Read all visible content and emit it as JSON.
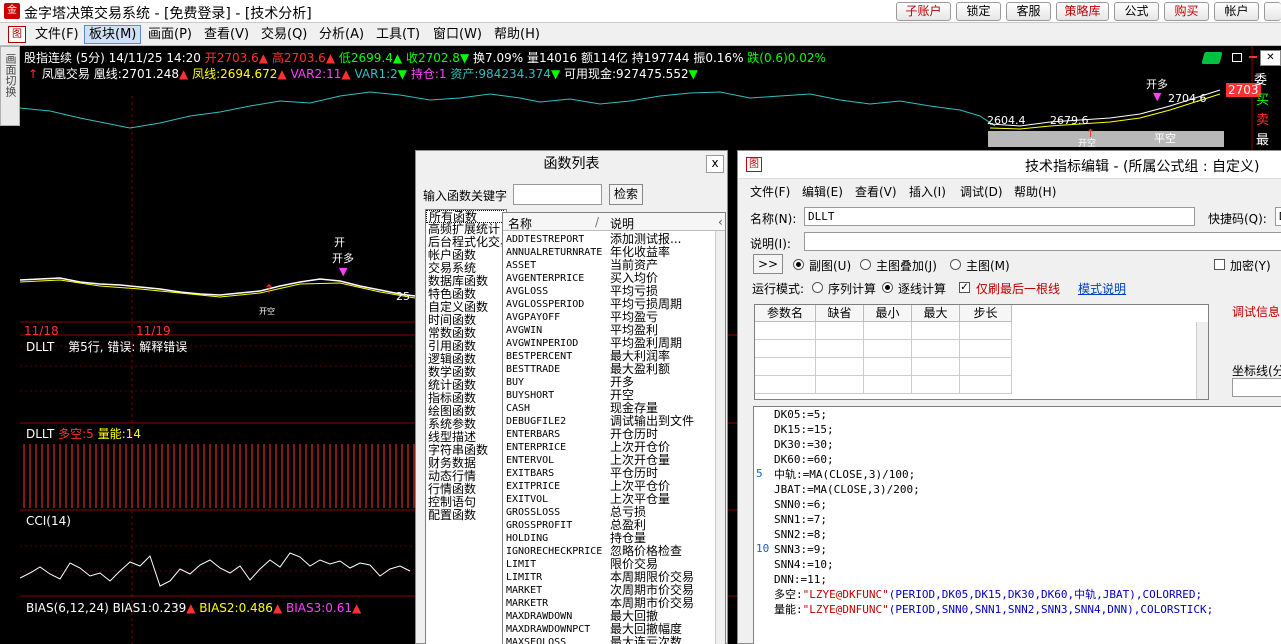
{
  "window": {
    "title": "金字塔决策交易系统 - [免费登录] - [技术分析]",
    "buttons": [
      "子账户",
      "锁定",
      "客服",
      "策略库",
      "公式",
      "购买",
      "帐户"
    ]
  },
  "menubar": {
    "items": [
      "文件(F)",
      "板块(M)",
      "画面(P)",
      "查看(V)",
      "交易(Q)",
      "分析(A)",
      "工具(T)",
      "窗口(W)",
      "帮助(H)"
    ],
    "selected": "板块(M)"
  },
  "left_tab": "画面切换",
  "quote": {
    "name": "股指连续 (5分) 14/11/25 14:20",
    "open": "开2703.6",
    "high": "高2703.6",
    "low": "低2699.4",
    "close": "收2702.8",
    "turnover": "换7.09%",
    "volume": "量14016",
    "amount": "额114亿",
    "position": "持197744",
    "amplitude": "振0.16%",
    "change": "跌(0.6)0.02%"
  },
  "indicator_line": {
    "name": "凤凰交易",
    "huang": "凰线:2701.248",
    "feng": "凤线:2694.672",
    "var2": "VAR2:11",
    "var1": "VAR1:2",
    "chicang": "持仓:1",
    "zichan": "资产:984234.374",
    "cash": "可用现金:927475.552"
  },
  "chart_labels": {
    "price_right": "2703",
    "top_right_a": "2704.6",
    "label_a": "2604.4",
    "label_b": "2679.6",
    "short_label": "25",
    "date1": "11/18",
    "date2": "11/19",
    "right_chars": [
      "委",
      "买",
      "卖",
      "最"
    ],
    "sell_mark": "开空",
    "buy_mark": "平空",
    "short_top": "开",
    "mark_pair": "开多"
  },
  "pane_dllt1": {
    "title": "DLLT",
    "error": "第5行, 错误: 解释错误"
  },
  "pane_dllt2": {
    "title": "DLLT",
    "duokong": "多空:5",
    "liangneng": "量能:14"
  },
  "pane_cci": {
    "title": "CCI(14)"
  },
  "pane_bias": {
    "title": "BIAS(6,12,24)",
    "bias1": "BIAS1:0.239",
    "bias2": "BIAS2:0.486",
    "bias3": "BIAS3:0.61"
  },
  "func_dialog": {
    "title": "函数列表",
    "close": "x",
    "keyword_label": "输入函数关键字",
    "search": "检索",
    "col_name": "名称",
    "col_desc": "说明",
    "categories": [
      "所有函数",
      "高频扩展统计",
      "后台程式化交易",
      "帐户函数",
      "交易系统",
      "数据库函数",
      "特色函数",
      "自定义函数",
      "时间函数",
      "常数函数",
      "引用函数",
      "逻辑函数",
      "数学函数",
      "统计函数",
      "指标函数",
      "绘图函数",
      "系统参数",
      "线型描述",
      "字符串函数",
      "财务数据",
      "动态行情",
      "行情函数",
      "控制语句",
      "配置函数"
    ],
    "functions": [
      [
        "ADDTESTREPORT",
        "添加测试报..."
      ],
      [
        "ANNUALRETURNRATE",
        "年化收益率"
      ],
      [
        "ASSET",
        "当前资产"
      ],
      [
        "AVGENTERPRICE",
        "买入均价"
      ],
      [
        "AVGLOSS",
        "平均亏损"
      ],
      [
        "AVGLOSSPERIOD",
        "平均亏损周期"
      ],
      [
        "AVGPAYOFF",
        "平均盈亏"
      ],
      [
        "AVGWIN",
        "平均盈利"
      ],
      [
        "AVGWINPERIOD",
        "平均盈利周期"
      ],
      [
        "BESTPERCENT",
        "最大利润率"
      ],
      [
        "BESTTRADE",
        "最大盈利额"
      ],
      [
        "BUY",
        "开多"
      ],
      [
        "BUYSHORT",
        "开空"
      ],
      [
        "CASH",
        "现金存量"
      ],
      [
        "DEBUGFILE2",
        "调试输出到文件"
      ],
      [
        "ENTERBARS",
        "开仓历时"
      ],
      [
        "ENTERPRICE",
        "上次开仓价"
      ],
      [
        "ENTERVOL",
        "上次开仓量"
      ],
      [
        "EXITBARS",
        "平仓历时"
      ],
      [
        "EXITPRICE",
        "上次平仓价"
      ],
      [
        "EXITVOL",
        "上次平仓量"
      ],
      [
        "GROSSLOSS",
        "总亏损"
      ],
      [
        "GROSSPROFIT",
        "总盈利"
      ],
      [
        "HOLDING",
        "持仓量"
      ],
      [
        "IGNORECHECKPRICE",
        "忽略价格检查"
      ],
      [
        "LIMIT",
        "限价交易"
      ],
      [
        "LIMITR",
        "本周期限价交易"
      ],
      [
        "MARKET",
        "次周期市价交易"
      ],
      [
        "MARKETR",
        "本周期市价交易"
      ],
      [
        "MAXDRAWDOWN",
        "最大回撤"
      ],
      [
        "MAXDRAWDOWNPCT",
        "最大回撤幅度"
      ],
      [
        "MAXSEQLOSS",
        "最大连亏次数"
      ]
    ]
  },
  "editor_dialog": {
    "title": "技术指标编辑 - (所属公式组 : 自定义)",
    "menu": [
      "文件(F)",
      "编辑(E)",
      "查看(V)",
      "插入(I)",
      "调试(D)",
      "帮助(H)"
    ],
    "name_label": "名称(N):",
    "name_value": "DLLT",
    "hotkey_label": "快捷码(Q):",
    "hotkey_value": "D",
    "desc_label": "说明(I):",
    "expand_button": ">>",
    "chart_modes": [
      "副图(U)",
      "主图叠加(J)",
      "主图(M)"
    ],
    "encrypt_label": "加密(Y)",
    "run_mode_label": "运行模式:",
    "run_modes": [
      "序列计算",
      "逐线计算"
    ],
    "refresh_last": "仅刷最后一根线",
    "mode_help": "模式说明",
    "param_headers": [
      "参数名",
      "缺省",
      "最小",
      "最大",
      "步长"
    ],
    "debug_info": "调试信息",
    "axis_label": "坐标线(分",
    "code_lines": [
      "DK05:=5;",
      "DK15:=15;",
      "DK30:=30;",
      "DK60:=60;",
      "中轨:=MA(CLOSE,3)/100;",
      "JBAT:=MA(CLOSE,3)/200;",
      "SNN0:=6;",
      "SNN1:=7;",
      "SNN2:=8;",
      "SNN3:=9;",
      "SNN4:=10;",
      "DNN:=11;"
    ],
    "code_duo_prefix": "多空:",
    "code_duo_str": "\"LZYE@DKFUNC\"",
    "code_duo_rest": "(PERIOD,DK05,DK15,DK30,DK60,中轨,JBAT),COLORRED;",
    "code_liang_prefix": "量能:",
    "code_liang_str": "\"LZYE@DNFUNC\"",
    "code_liang_rest": "(PERIOD,SNN0,SNN1,SNN2,SNN3,SNN4,DNN),COLORSTICK;",
    "line_numbers": [
      "5",
      "10"
    ]
  },
  "colors": {
    "up": "#ff3030",
    "down": "#00ff00",
    "yellow": "#ffff00",
    "magenta": "#ff40ff",
    "cyan": "#30c0c0",
    "grid": "#8b0000"
  }
}
